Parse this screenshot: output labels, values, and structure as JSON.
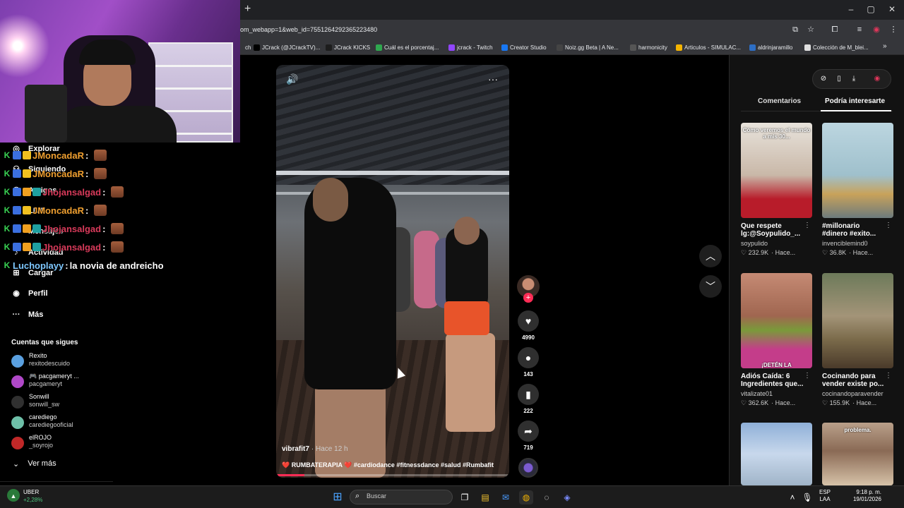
{
  "browser": {
    "new_tab": "+",
    "window_controls": {
      "minimize": "–",
      "restore": "▢",
      "close": "✕"
    },
    "url": "om_webapp=1&web_id=7551264292365223480",
    "bookmarks": [
      {
        "label": "ch",
        "color": "#35363a"
      },
      {
        "label": "JCrack (@JCrackTV)...",
        "color": "#000000"
      },
      {
        "label": "JCrack KICKS",
        "color": "#1d1d1d"
      },
      {
        "label": "Cuál es el porcentaj...",
        "color": "#2fa84f"
      },
      {
        "label": "jcrack - Twitch",
        "color": "#9146ff"
      },
      {
        "label": "Creator Studio",
        "color": "#1877f2"
      },
      {
        "label": "Noiz.gg Beta | A Ne...",
        "color": "#444444"
      },
      {
        "label": "harmonicity",
        "color": "#555555"
      },
      {
        "label": "Articulos - SIMULAC...",
        "color": "#f4b400"
      },
      {
        "label": "aldrinjaramillo",
        "color": "#2d6ec4"
      },
      {
        "label": "Colección de M_blei...",
        "color": "#e0e0e0"
      }
    ],
    "bookmarks_more": "»"
  },
  "sidebar": {
    "nav": [
      {
        "label": "Explorar",
        "icon": "compass-icon",
        "glyph": "◎"
      },
      {
        "label": "Siguiendo",
        "icon": "user-icon",
        "glyph": "⚇"
      },
      {
        "label": "Amigos",
        "icon": "friends-icon",
        "glyph": "⚇"
      },
      {
        "label": "LIVE",
        "icon": "live-icon",
        "glyph": "▣"
      },
      {
        "label": "Mensajes",
        "icon": "message-icon",
        "glyph": "✉"
      },
      {
        "label": "Actividad",
        "icon": "bell-icon",
        "glyph": "♪"
      },
      {
        "label": "Cargar",
        "icon": "upload-icon",
        "glyph": "⊞"
      },
      {
        "label": "Perfil",
        "icon": "profile-icon",
        "glyph": "◉"
      },
      {
        "label": "Más",
        "icon": "more-icon",
        "glyph": "···"
      }
    ],
    "following_title": "Cuentas que sigues",
    "following": [
      {
        "name": "Rexito",
        "handle": "rexitodescuido",
        "color": "#5aa0e0"
      },
      {
        "name": "🎮 pacgameryt ...",
        "handle": "pacgameryt",
        "color": "#b048c8"
      },
      {
        "name": "Sonwill",
        "handle": "sonwill_sw",
        "color": "#303030"
      },
      {
        "name": "carediego",
        "handle": "carediegooficial",
        "color": "#6ec0a8"
      },
      {
        "name": "elROJO",
        "handle": "_soyrojo",
        "color": "#c02828"
      }
    ],
    "see_more": "Ver más"
  },
  "chat": [
    {
      "user": "JMoncadaR",
      "sep": " :",
      "msg": "",
      "color": "#f0a030",
      "emote": true
    },
    {
      "user": "JMoncadaR",
      "sep": " :",
      "msg": "",
      "color": "#f0a030",
      "emote": true
    },
    {
      "user": "Jhojansalgad",
      "sep": " :",
      "msg": "",
      "color": "#d83a5a",
      "emote": true
    },
    {
      "user": "JMoncadaR",
      "sep": " :",
      "msg": "",
      "color": "#f0a030",
      "emote": true
    },
    {
      "user": "Jhojansalgad",
      "sep": " :",
      "msg": "",
      "color": "#d83a5a",
      "emote": true
    },
    {
      "user": "Jhojansalgad",
      "sep": " :",
      "msg": "",
      "color": "#d83a5a",
      "emote": true
    },
    {
      "user": "Luchoplayy",
      "sep": " :",
      "msg": " la novia de andreicho",
      "color": "#7ec8ff",
      "emote": false
    }
  ],
  "video": {
    "user": "vibrafit7",
    "time": "· Hace 12 h",
    "caption": "❤️ RUMBATERAPIA ❤️ #cardiodance #fitnessdance #salud #Rumbafit",
    "progress": 0.12
  },
  "actions": [
    {
      "name": "like",
      "glyph": "♥",
      "count": "4990"
    },
    {
      "name": "comment",
      "glyph": "●",
      "count": "143"
    },
    {
      "name": "save",
      "glyph": "▮",
      "count": "222"
    },
    {
      "name": "share",
      "glyph": "➦",
      "count": "719"
    }
  ],
  "right_panel": {
    "tabs": [
      "Comentarios",
      "Podría interesarte"
    ],
    "active_tab": 1,
    "cards": [
      {
        "title1": "Que respete",
        "title2": "lg:@Soypulido_...",
        "author": "soypulido",
        "likes": "♡ 232.9K",
        "ago": "· Hace...",
        "thumb_text": "Cómo veremos el mundo a mis 30...",
        "bg": "linear-gradient(#e8e3dc,#c9b8a8 55%,#b81c2a 80%)"
      },
      {
        "title1": "#millonario",
        "title2": "#dinero #exito...",
        "author": "invenciblemind0",
        "likes": "♡ 36.8K",
        "ago": "· Hace...",
        "thumb_text": "",
        "bg": "linear-gradient(#bcd6e0,#9fc0cc 55%,#c8a25a 75%,#6d7b7d)"
      },
      {
        "title1": "Adiós Caída: 6",
        "title2": "Ingredientes que...",
        "author": "vitalizate01",
        "likes": "♡ 362.6K",
        "ago": "· Hace...",
        "thumb_text": "¡DETÉN LA",
        "bg": "linear-gradient(#c58a74,#a06650 45%,#7a9a3a 60%,#c43d8a 80%)"
      },
      {
        "title1": "Cocinando para",
        "title2": "vender existe po...",
        "author": "cocinandoparavender",
        "likes": "♡ 155.9K",
        "ago": "· Hace...",
        "thumb_text": "",
        "bg": "linear-gradient(#6d7a5a,#a39478 45%,#7a6a4a 70%,#4a3a2a)"
      },
      {
        "title1": "",
        "title2": "",
        "author": "",
        "likes": "",
        "ago": "",
        "thumb_text": "",
        "bg": "linear-gradient(#8fb0d8,#c8d8ec 50%,#a0b4c8)"
      },
      {
        "title1": "",
        "title2": "",
        "author": "",
        "likes": "",
        "ago": "",
        "thumb_text": "problema.",
        "bg": "linear-gradient(#b9a08a,#8a6a55 45%,#d6c2a8)"
      }
    ]
  },
  "taskbar": {
    "stock_name": "UBER",
    "stock_change": "+2,28%",
    "search_placeholder": "Buscar",
    "lang1": "ESP",
    "lang2": "LAA",
    "time": "9:18 p. m.",
    "date": "19/01/2026"
  }
}
